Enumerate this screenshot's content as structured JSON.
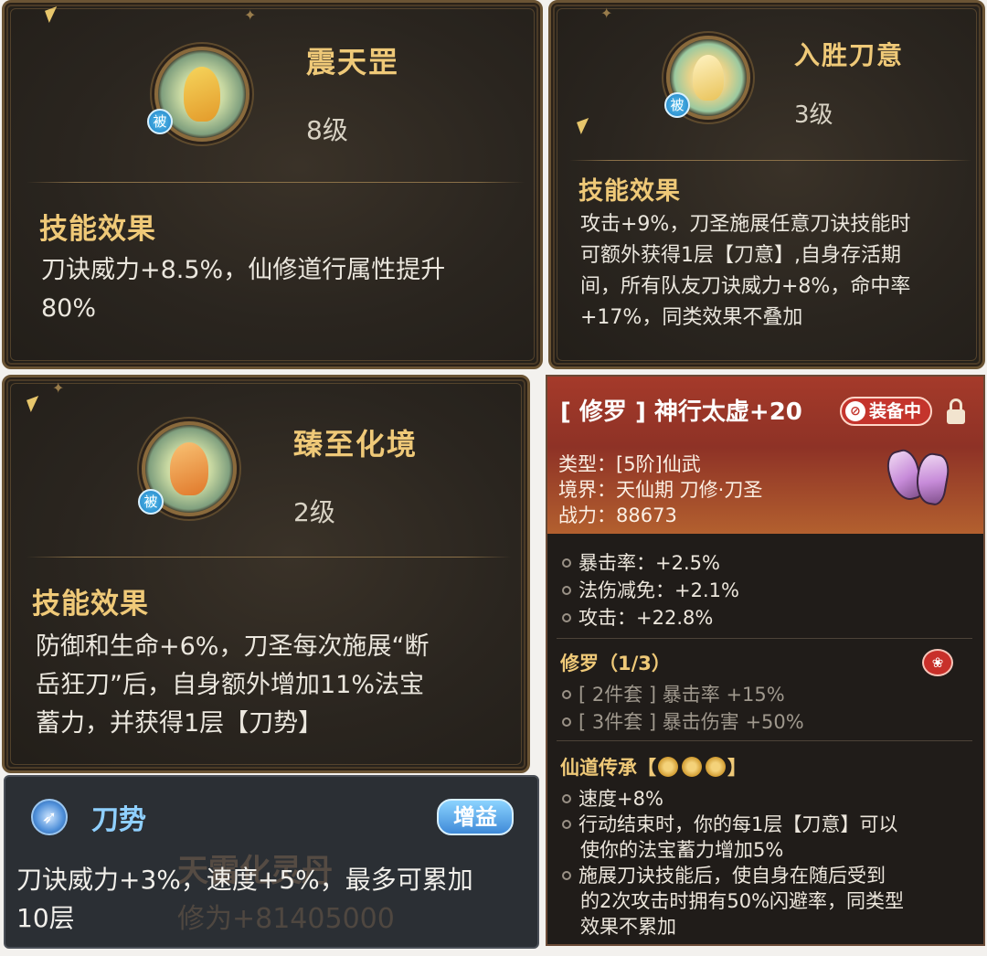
{
  "skills": [
    {
      "name": "震天罡",
      "level": "8级",
      "badge": "被",
      "effect_title": "技能效果",
      "effect_lines": [
        "刀诀威力+8.5%，仙修道行属性提升",
        "80%"
      ]
    },
    {
      "name": "入胜刀意",
      "level": "3级",
      "badge": "被",
      "effect_title": "技能效果",
      "effect_lines": [
        "攻击+9%，刀圣施展任意刀诀技能时",
        "可额外获得1层【刀意】,自身存活期",
        "间，所有队友刀诀威力+8%，命中率",
        "+17%，同类效果不叠加"
      ]
    },
    {
      "name": "臻至化境",
      "level": "2级",
      "badge": "被",
      "effect_title": "技能效果",
      "effect_lines": [
        "防御和生命+6%，刀圣每次施展“断",
        "岳狂刀”后，自身额外增加11%法宝",
        "蓄力，并获得1层【刀势】"
      ]
    }
  ],
  "equipment": {
    "title": "[ 修罗 ] 神行太虚+20",
    "equipped_label": "装备中",
    "type_line": "类型：[5阶]仙武",
    "realm_line": "境界：天仙期 刀修·刀圣",
    "power_line": "战力：88673",
    "stats": [
      "暴击率：+2.5%",
      "法伤减免：+2.1%",
      "攻击：+22.8%"
    ],
    "set_title": "修罗（1/3）",
    "set_items": [
      "[ 2件套 ] 暴击率 +15%",
      "[ 3件套 ] 暴击伤害 +50%"
    ],
    "legacy_title_left": "仙道传承【",
    "legacy_title_right": "】",
    "legacy_items": [
      "速度+8%",
      "行动结束时，你的每1层【刀意】可以",
      "使你的法宝蓄力增加5%",
      "施展刀诀技能后，使自身在随后受到",
      "的2次攻击时拥有50%闪避率，同类型",
      "效果不累加"
    ]
  },
  "buff": {
    "name": "刀势",
    "tag": "增益",
    "text_lines": [
      "刀诀威力+3%，速度+5%，最多可累加",
      "10层"
    ],
    "ghost_title": "天雷化灵丹",
    "ghost_value": "修为+81405000"
  },
  "colors": {
    "gold_text": "#efc978",
    "panel_border": "#6b5434",
    "equip_header": "#a53a2a",
    "buff_name": "#8fd0ff"
  },
  "icons": [
    "skill-icon-zhentiangang",
    "skill-icon-rushengdaoyi",
    "skill-icon-zhenzhihuajing",
    "boots-icon",
    "lotus-icon",
    "cloud-swirl-icon",
    "buff-blade-icon",
    "lock-icon"
  ]
}
